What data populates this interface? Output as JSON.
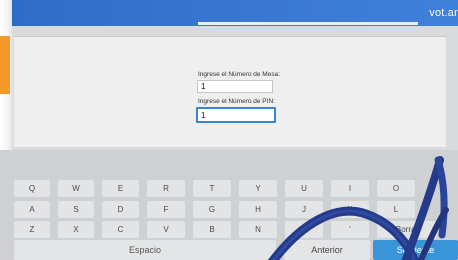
{
  "header": {
    "brand": "vot.ar"
  },
  "form": {
    "mesa_label": "Ingrese el Número de Mesa:",
    "mesa_value": "1",
    "pin_label": "Ingrese el Número de PIN:",
    "pin_value": "1"
  },
  "keyboard": {
    "row1": [
      "Q",
      "W",
      "E",
      "R",
      "T",
      "Y",
      "U",
      "I",
      "O"
    ],
    "row2": [
      "A",
      "S",
      "D",
      "F",
      "G",
      "H",
      "J",
      "K",
      "L"
    ],
    "row3": [
      "Z",
      "X",
      "C",
      "V",
      "B",
      "N",
      "M",
      "'",
      "Borrar"
    ],
    "space_label": "Espacio",
    "prev_label": "Anterior",
    "next_label": "Siguiente"
  },
  "colors": {
    "header": "#3c7bd4",
    "accent": "#f39a2a",
    "next_key": "#3a94d8",
    "lanyard": "#2a3f8f"
  }
}
